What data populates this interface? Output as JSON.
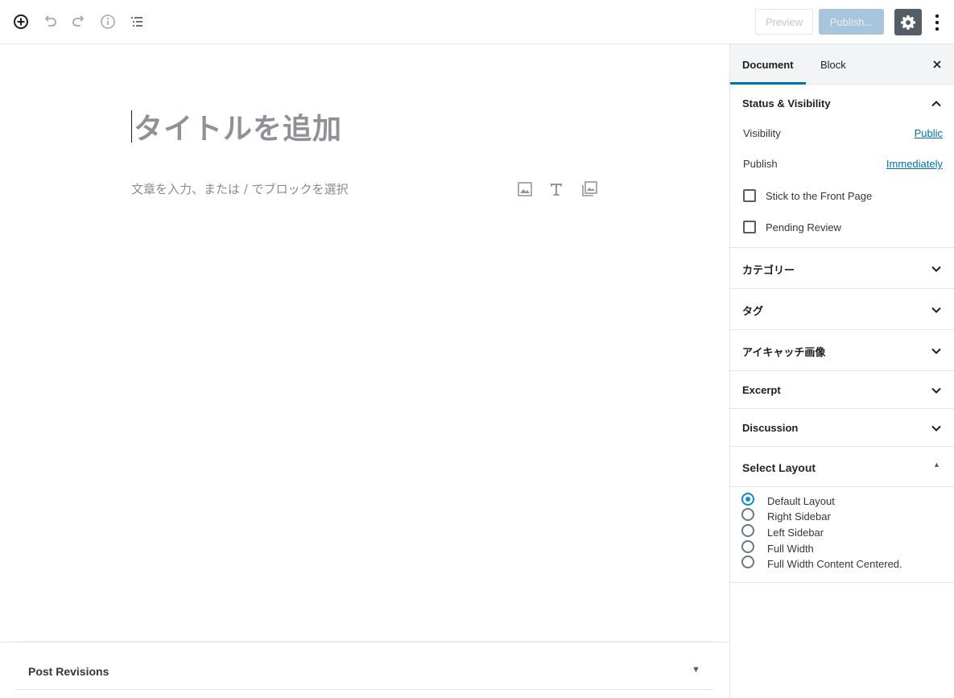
{
  "toolbar": {
    "preview_label": "Preview",
    "publish_label": "Publish...",
    "icons": [
      "add-block-icon",
      "undo-icon",
      "redo-icon",
      "info-icon",
      "outline-icon",
      "gear-icon",
      "more-vertical-icon"
    ]
  },
  "editor": {
    "title_placeholder": "タイトルを追加",
    "body_placeholder": "文章を入力、または / でブロックを選択",
    "inserter_icons": [
      "image-icon",
      "heading-icon",
      "gallery-icon"
    ]
  },
  "meta_boxes": {
    "post_revisions": "Post Revisions",
    "toggle": "▼"
  },
  "sidebar": {
    "tabs": [
      "Document",
      "Block"
    ],
    "active_tab": "Document",
    "status": {
      "title": "Status & Visibility",
      "visibility_label": "Visibility",
      "visibility_value": "Public",
      "publish_label": "Publish",
      "publish_value": "Immediately",
      "sticky_label": "Stick to the Front Page",
      "pending_label": "Pending Review"
    },
    "panels": [
      "カテゴリー",
      "タグ",
      "アイキャッチ画像",
      "Excerpt",
      "Discussion"
    ],
    "layout": {
      "title": "Select Layout",
      "toggle": "▲",
      "options": [
        "Default Layout",
        "Right Sidebar",
        "Left Sidebar",
        "Full Width",
        "Full Width Content Centered."
      ],
      "selected": "Default Layout"
    }
  },
  "colors": {
    "accent": "#0073aa",
    "radio_selected": "#0a8cd0",
    "publish_disabled": "#a7c5dc",
    "settings_bg": "#555d66"
  }
}
